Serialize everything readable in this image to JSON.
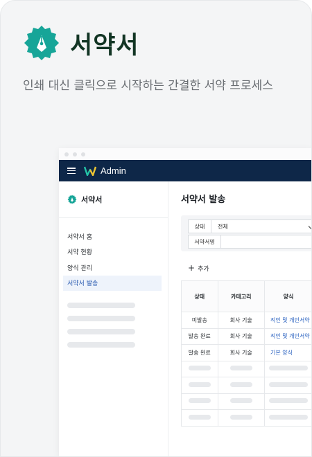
{
  "hero": {
    "brand_name": "서약서",
    "tagline": "인쇄 대신 클릭으로 시작하는 간결한 서약 프로세스"
  },
  "topbar": {
    "title": "Admin"
  },
  "sidebar": {
    "brand": "서약서",
    "items": [
      {
        "label": "서약서 홈",
        "active": false
      },
      {
        "label": "서약 현황",
        "active": false
      },
      {
        "label": "양식 관리",
        "active": false
      },
      {
        "label": "서약서 발송",
        "active": true
      }
    ]
  },
  "main": {
    "title": "서약서 발송",
    "filters": {
      "status_label": "상태",
      "status_value": "전체",
      "name_label": "서약서명",
      "name_value": ""
    },
    "add_label": "추가",
    "table": {
      "columns": [
        "상태",
        "카테고리",
        "양식"
      ],
      "rows": [
        {
          "status": "미발송",
          "category": "회사 기술",
          "form": "직인 및 개인서약"
        },
        {
          "status": "발송 완료",
          "category": "회사 기술",
          "form": "직인 및 개인서약"
        },
        {
          "status": "발송 완료",
          "category": "회사 기술",
          "form": "기본 양식"
        }
      ]
    }
  },
  "colors": {
    "brand_teal": "#17a598",
    "brand_dark": "#123524",
    "topbar": "#0e2748",
    "link": "#2a62c0"
  },
  "icons": [
    "pen-nib-badge-icon",
    "hamburger-icon",
    "w-logo-icon",
    "plus-icon",
    "chevron-down-icon"
  ]
}
